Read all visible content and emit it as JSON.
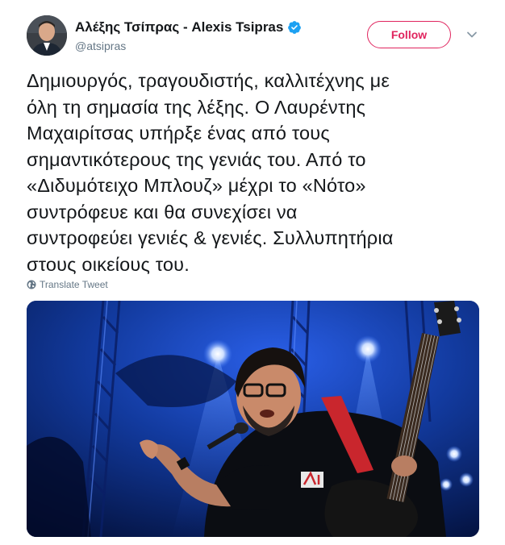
{
  "tweet": {
    "author": {
      "display_name": "Αλέξης Τσίπρας - Alexis Tsipras",
      "handle": "@atsipras",
      "verified": true,
      "avatar_icon": "profile-photo"
    },
    "follow_label": "Follow",
    "menu_icon": "chevron-down-icon",
    "text": "Δημιουργός, τραγουδιστής, καλλιτέχνης με\nόλη τη σημασία της λέξης. Ο Λαυρέντης\nΜαχαιρίτσας υπήρξε ένας από τους\nσημαντικότερους της γενιάς του. Από το\n«Διδυμότειχο Μπλουζ» μέχρι το «Νότο»\nσυντρόφευε και θα συνεχίσει να\nσυντροφεύει γενιές & γενιές. Συλλυπητήρια\nστους οικείους του.",
    "translate_label": "Translate Tweet",
    "translate_icon": "globe-icon",
    "media": {
      "type": "photo",
      "subject": "guitarist-singing-on-stage"
    }
  },
  "colors": {
    "accent": "#e0245e",
    "verified": "#1da1f2",
    "secondary_text": "#657786",
    "stage_blue": "#0b2a8a"
  }
}
